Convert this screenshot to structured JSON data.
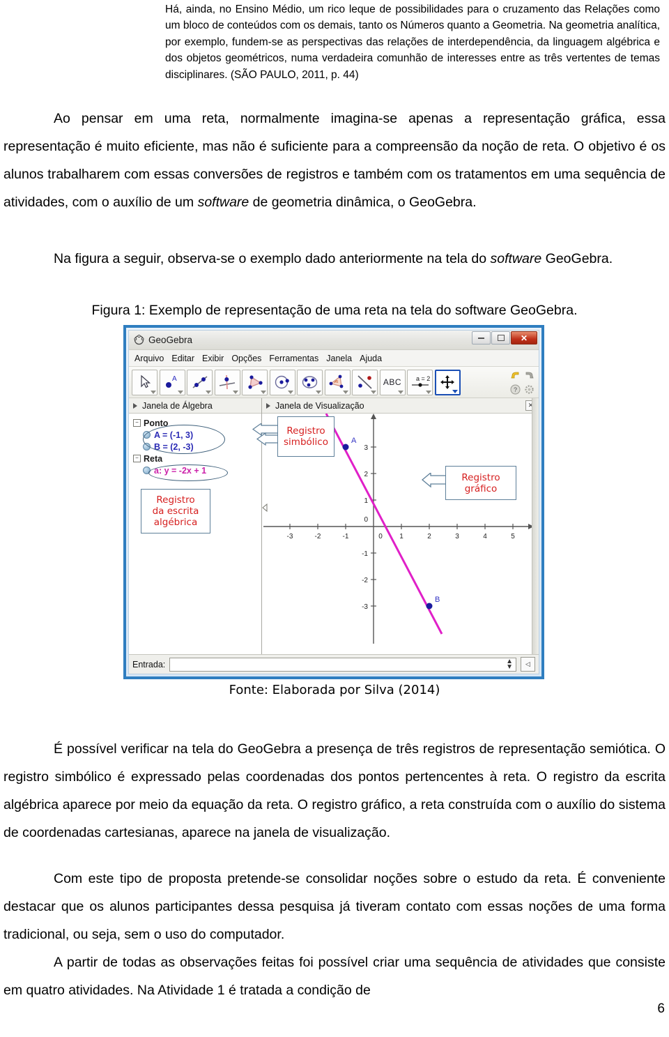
{
  "quote": {
    "lines": [
      "Há, ainda, no Ensino Médio, um rico leque de possibilidades para o cruzamento das Relações como um bloco de conteúdos com os demais, tanto os Números quanto a Geometria. Na geometria analítica, por exemplo, fundem-se as perspectivas das relações de interdependência, da linguagem algébrica e dos objetos geométricos, numa verdadeira comunhão de interesses entre as três vertentes de temas disciplinares. (SÃO PAULO, 2011, p. 44)"
    ]
  },
  "paragraphs": {
    "p1_part1": "Ao pensar em uma reta, normalmente imagina-se apenas a representação gráfica, essa representação é muito eficiente, mas não é suficiente para a compreensão da noção de reta. O objetivo é os alunos trabalharem com essas conversões de registros e também com os tratamentos em uma sequência de atividades, com o auxílio de um ",
    "p1_em": "software",
    "p1_part2": " de geometria dinâmica, o GeoGebra.",
    "p2_part1": "Na figura a seguir, observa-se o exemplo dado anteriormente na tela do ",
    "p2_em": "software",
    "p2_part2": " GeoGebra.",
    "p3": "É possível verificar na tela do GeoGebra a presença de três registros de representação semiótica. O registro simbólico é expressado pelas coordenadas dos pontos pertencentes à reta. O registro da escrita algébrica aparece por meio da equação da reta. O registro gráfico, a reta construída com o auxílio do sistema de coordenadas cartesianas, aparece na janela de visualização.",
    "p4": "Com este tipo de proposta pretende-se consolidar noções sobre o estudo da reta.  É conveniente destacar que os alunos participantes dessa pesquisa já tiveram contato com essas noções de uma forma tradicional, ou seja, sem o uso do computador.",
    "p5": "A partir de todas as observações feitas foi possível criar uma sequência de atividades que consiste em quatro atividades. Na Atividade 1 é tratada a condição de"
  },
  "figure": {
    "caption": "Figura 1: Exemplo de representação de uma reta na tela do software GeoGebra.",
    "source": "Fonte: Elaborada por Silva (2014)"
  },
  "geogebra": {
    "title": "GeoGebra",
    "window_buttons": {
      "minimize": "minimize-icon",
      "maximize": "maximize-icon",
      "close": "✕"
    },
    "menu": [
      "Arquivo",
      "Editar",
      "Exibir",
      "Opções",
      "Ferramentas",
      "Janela",
      "Ajuda"
    ],
    "toolbar_tools": [
      {
        "name": "move-tool",
        "glyph": "arrow-cursor",
        "selected": false
      },
      {
        "name": "point-tool",
        "glyph": "point-A",
        "selected": false
      },
      {
        "name": "line-tool",
        "glyph": "line-through-points",
        "selected": false
      },
      {
        "name": "perpendicular-line-tool",
        "glyph": "perpendicular-line",
        "selected": false
      },
      {
        "name": "polygon-tool",
        "glyph": "triangle",
        "selected": false
      },
      {
        "name": "circle-tool",
        "glyph": "circle-center-point",
        "selected": false
      },
      {
        "name": "conic-tool",
        "glyph": "ellipse-points",
        "selected": false
      },
      {
        "name": "angle-tool",
        "glyph": "angle-measure",
        "selected": false
      },
      {
        "name": "reflect-tool",
        "glyph": "reflect-about-line",
        "selected": false
      },
      {
        "name": "text-tool",
        "glyph": "ABC",
        "selected": false
      },
      {
        "name": "slider-tool",
        "glyph": "a = 2",
        "selected": false
      },
      {
        "name": "move-graphics-view-tool",
        "glyph": "move-cross",
        "selected": true
      }
    ],
    "toolbar_right": [
      "undo-icon",
      "redo-icon",
      "help-icon",
      "settings-icon"
    ],
    "panes": {
      "algebra_header": "Janela de Álgebra",
      "graphics_header": "Janela de Visualização"
    },
    "algebra": {
      "groups": [
        {
          "label": "Ponto",
          "items": [
            "A = (-1, 3)",
            "B = (2, -3)"
          ]
        },
        {
          "label": "Reta",
          "items": [
            "a: y = -2x + 1"
          ]
        }
      ]
    },
    "callouts": [
      {
        "name": "callout-registro-simbolico",
        "lines": [
          "Registro",
          "simbólico"
        ]
      },
      {
        "name": "callout-registro-escrita-algebrica",
        "lines": [
          "Registro",
          "da escrita",
          "algébrica"
        ]
      },
      {
        "name": "callout-registro-grafico",
        "lines": [
          "Registro",
          "gráfico"
        ]
      }
    ],
    "entry": {
      "label": "Entrada:",
      "value": ""
    }
  },
  "chart_data": {
    "type": "line",
    "title": "",
    "xlabel": "",
    "ylabel": "",
    "xlim": [
      -3.6,
      5.6
    ],
    "ylim": [
      -3.9,
      3.9
    ],
    "xticks": [
      -3,
      -2,
      -1,
      0,
      1,
      2,
      3,
      4,
      5
    ],
    "yticks": [
      3,
      2,
      1,
      0,
      -1,
      -2,
      -3
    ],
    "grid": false,
    "origin_label": "0",
    "series": [
      {
        "name": "a: y = -2x + 1",
        "equation": "y = -2x + 1",
        "slope": -2,
        "intercept": 1,
        "color": "#e020c8",
        "x": [
          -1,
          2
        ],
        "y": [
          3,
          -3
        ]
      }
    ],
    "points": [
      {
        "label": "A",
        "x": -1,
        "y": 3,
        "color": "#1b1b9e"
      },
      {
        "label": "B",
        "x": 2,
        "y": -3,
        "color": "#1b1b9e"
      }
    ]
  },
  "page_number": "6"
}
